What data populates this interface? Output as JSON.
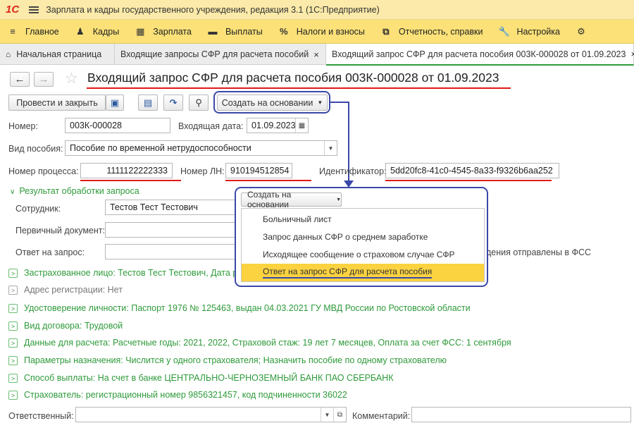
{
  "app": {
    "logo": "1С",
    "title": "Зарплата и кадры государственного учреждения, редакция 3.1  (1С:Предприятие)"
  },
  "menu": [
    {
      "label": "Главное",
      "icon": "≡"
    },
    {
      "label": "Кадры",
      "icon": "♟"
    },
    {
      "label": "Зарплата",
      "icon": "▦"
    },
    {
      "label": "Выплаты",
      "icon": "▬"
    },
    {
      "label": "Налоги и взносы",
      "icon": "%"
    },
    {
      "label": "Отчетность, справки",
      "icon": "⧉"
    },
    {
      "label": "Настройка",
      "icon": "🔧"
    },
    {
      "label": "",
      "icon": "⚙"
    }
  ],
  "tabs": [
    {
      "label": "Начальная страница",
      "icon": "⌂"
    },
    {
      "label": "Входящие запросы СФР для расчета пособий",
      "close": "×"
    },
    {
      "label": "Входящий запрос СФР для расчета пособия 003К-000028 от 01.09.2023",
      "close": "×"
    }
  ],
  "document": {
    "title": "Входящий запрос СФР для расчета пособия 003К-000028 от 01.09.2023"
  },
  "toolbar": {
    "post_close": "Провести и закрыть",
    "create_based": "Создать на основании"
  },
  "form": {
    "number_label": "Номер:",
    "number": "003К-000028",
    "incoming_date_label": "Входящая дата:",
    "incoming_date": "01.09.2023",
    "benefit_type_label": "Вид пособия:",
    "benefit_type": "Пособие по временной нетрудоспособности",
    "process_number_label": "Номер процесса:",
    "process_number": "1111122222333",
    "ln_number_label": "Номер ЛН:",
    "ln_number": "910194512854",
    "identifier_label": "Идентификатор:",
    "identifier": "5dd20fc8-41c0-4545-8a33-f9326b6aa252"
  },
  "result_section": {
    "title": "Результат обработки запроса",
    "employee_label": "Сотрудник:",
    "employee": "Тестов Тест Тестович",
    "primary_doc_label": "Первичный документ:",
    "answer_label": "Ответ на запрос:",
    "answer_note": "дения отправлены в ФСС"
  },
  "popup": {
    "button": "Создать на основании",
    "items": [
      "Больничный лист",
      "Запрос данных СФР о среднем заработке",
      "Исходящее сообщение о страховом случае СФР",
      "Ответ на запрос СФР для расчета пособия"
    ]
  },
  "sections": [
    {
      "text": "Застрахованное лицо: Тестов Тест Тестович, Дата рож",
      "gray": false
    },
    {
      "text": "Адрес регистрации: Нет",
      "gray": true
    },
    {
      "text": "Удостоверение личности: Паспорт 1976 № 125463, выдан 04.03.2021 ГУ МВД России по Ростовской области",
      "gray": false
    },
    {
      "text": "Вид договора: Трудовой",
      "gray": false
    },
    {
      "text": "Данные для расчета: Расчетные годы: 2021, 2022, Страховой стаж: 19 лет 7 месяцев, Оплата за счет ФСС: 1 сентября",
      "gray": false
    },
    {
      "text": "Параметры назначения: Числится у одного страхователя; Назначить пособие по одному страхователю",
      "gray": false
    },
    {
      "text": "Способ выплаты: На счет в банке ЦЕНТРАЛЬНО-ЧЕРНОЗЕМНЫЙ БАНК ПАО СБЕРБАНК",
      "gray": false
    },
    {
      "text": "Страхователь: регистрационный номер 9856321457, код подчиненности 36022",
      "gray": false
    }
  ],
  "footer": {
    "responsible_label": "Ответственный:",
    "comment_label": "Комментарий:"
  },
  "colors": {
    "accent_green": "#2e9a3a",
    "annotation_blue": "#3b48a8",
    "annotation_red": "#e01919",
    "menu_yellow": "#fbe178",
    "selected_item": "#fbd23f"
  }
}
